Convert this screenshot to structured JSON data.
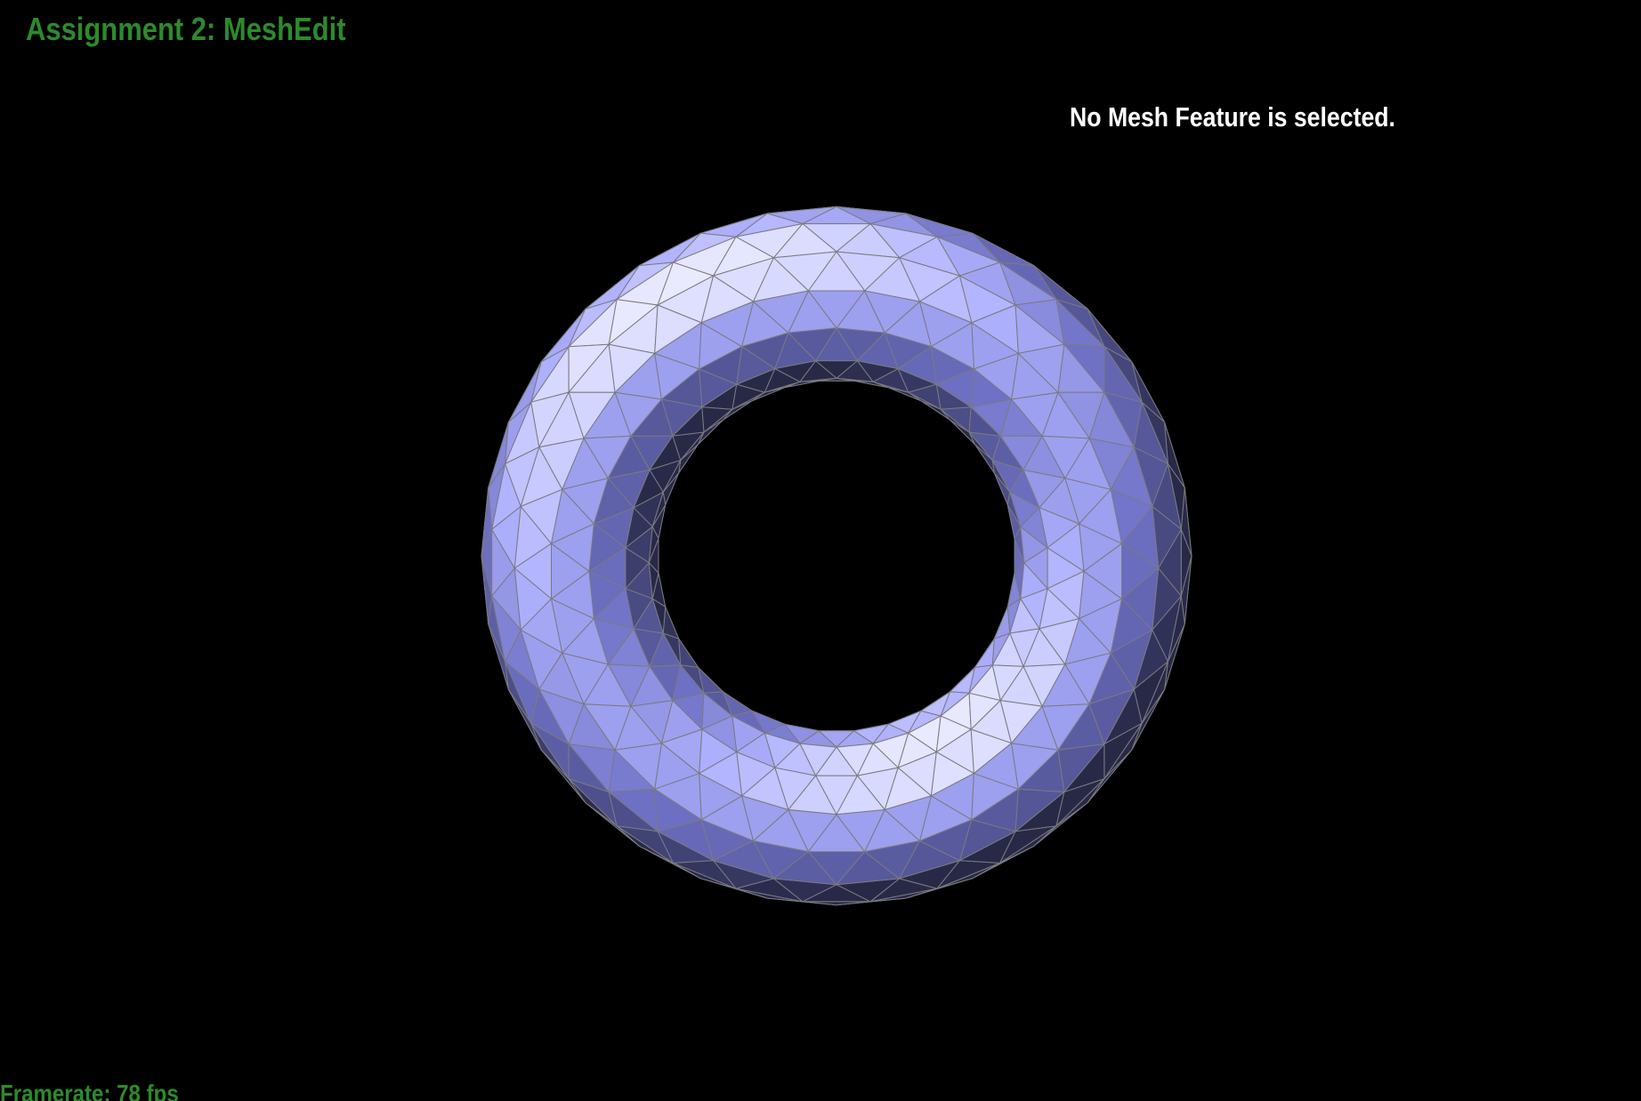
{
  "app": {
    "title": "Assignment 2: MeshEdit"
  },
  "viewer": {
    "selection_status": "No Mesh Feature is selected.",
    "framerate_label": "Framerate: 78 fps",
    "mesh": {
      "shape": "torus",
      "base_color": "#8f92ff",
      "edge_color": "#7a7a80",
      "background_color": "#000000"
    }
  },
  "colors": {
    "title": "#2d8a2d",
    "status_text": "#ffffff",
    "framerate": "#2d8a2d"
  }
}
